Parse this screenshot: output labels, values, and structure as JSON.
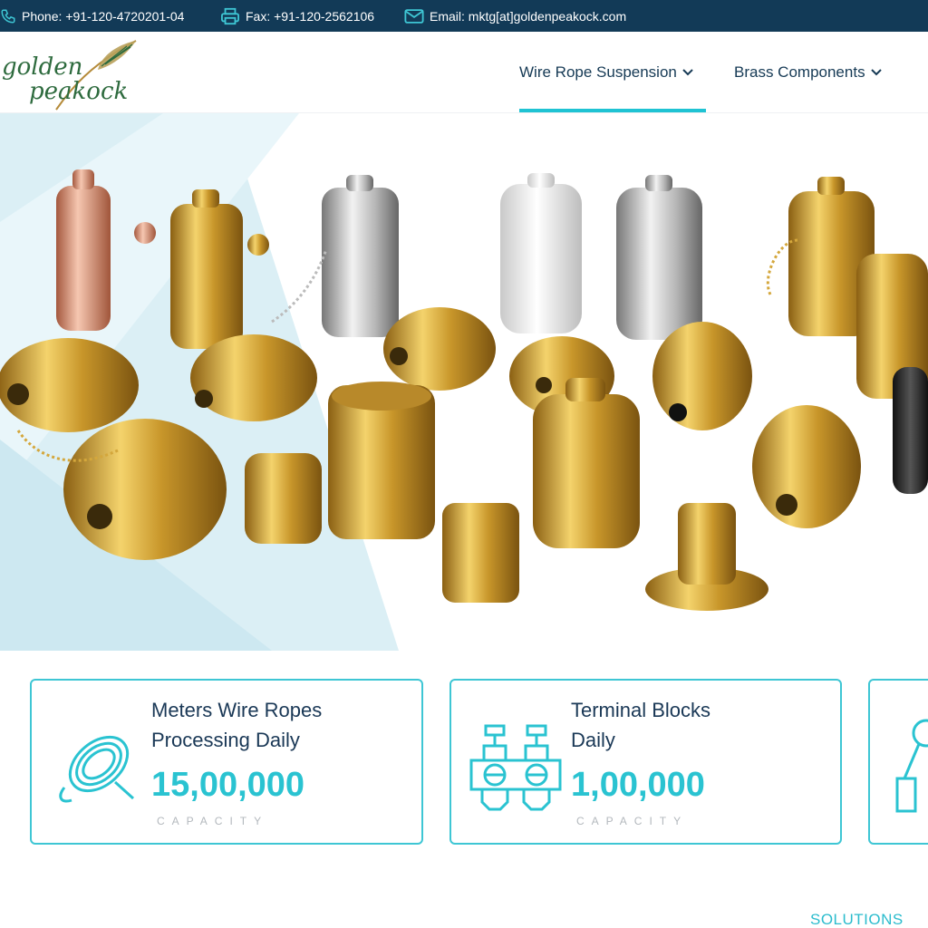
{
  "topbar": {
    "phone": "Phone: +91-120-4720201-04",
    "fax": "Fax: +91-120-2562106",
    "email": "Email: mktg[at]goldenpeakock.com"
  },
  "brand": {
    "line1": "golden",
    "line2": "peakock"
  },
  "nav": {
    "items": [
      {
        "label": "Wire Rope Suspension",
        "active": true
      },
      {
        "label": "Brass Components",
        "active": false
      }
    ]
  },
  "stats": [
    {
      "title_line1": "Meters Wire Ropes",
      "title_line2": "Processing Daily",
      "value": "15,00,000",
      "caption": "CAPACITY",
      "icon": "coiled-rope-icon"
    },
    {
      "title_line1": "Terminal Blocks",
      "title_line2": "Daily",
      "value": "1,00,000",
      "caption": "CAPACITY",
      "icon": "terminal-block-icon"
    },
    {
      "icon": "wire-gripper-icon"
    }
  ],
  "section": {
    "heading": "SOLUTIONS"
  },
  "colors": {
    "topbar": "#123a57",
    "accent": "#2ac3d1",
    "heading": "#1a3856",
    "logo_green": "#2e6b3e"
  }
}
